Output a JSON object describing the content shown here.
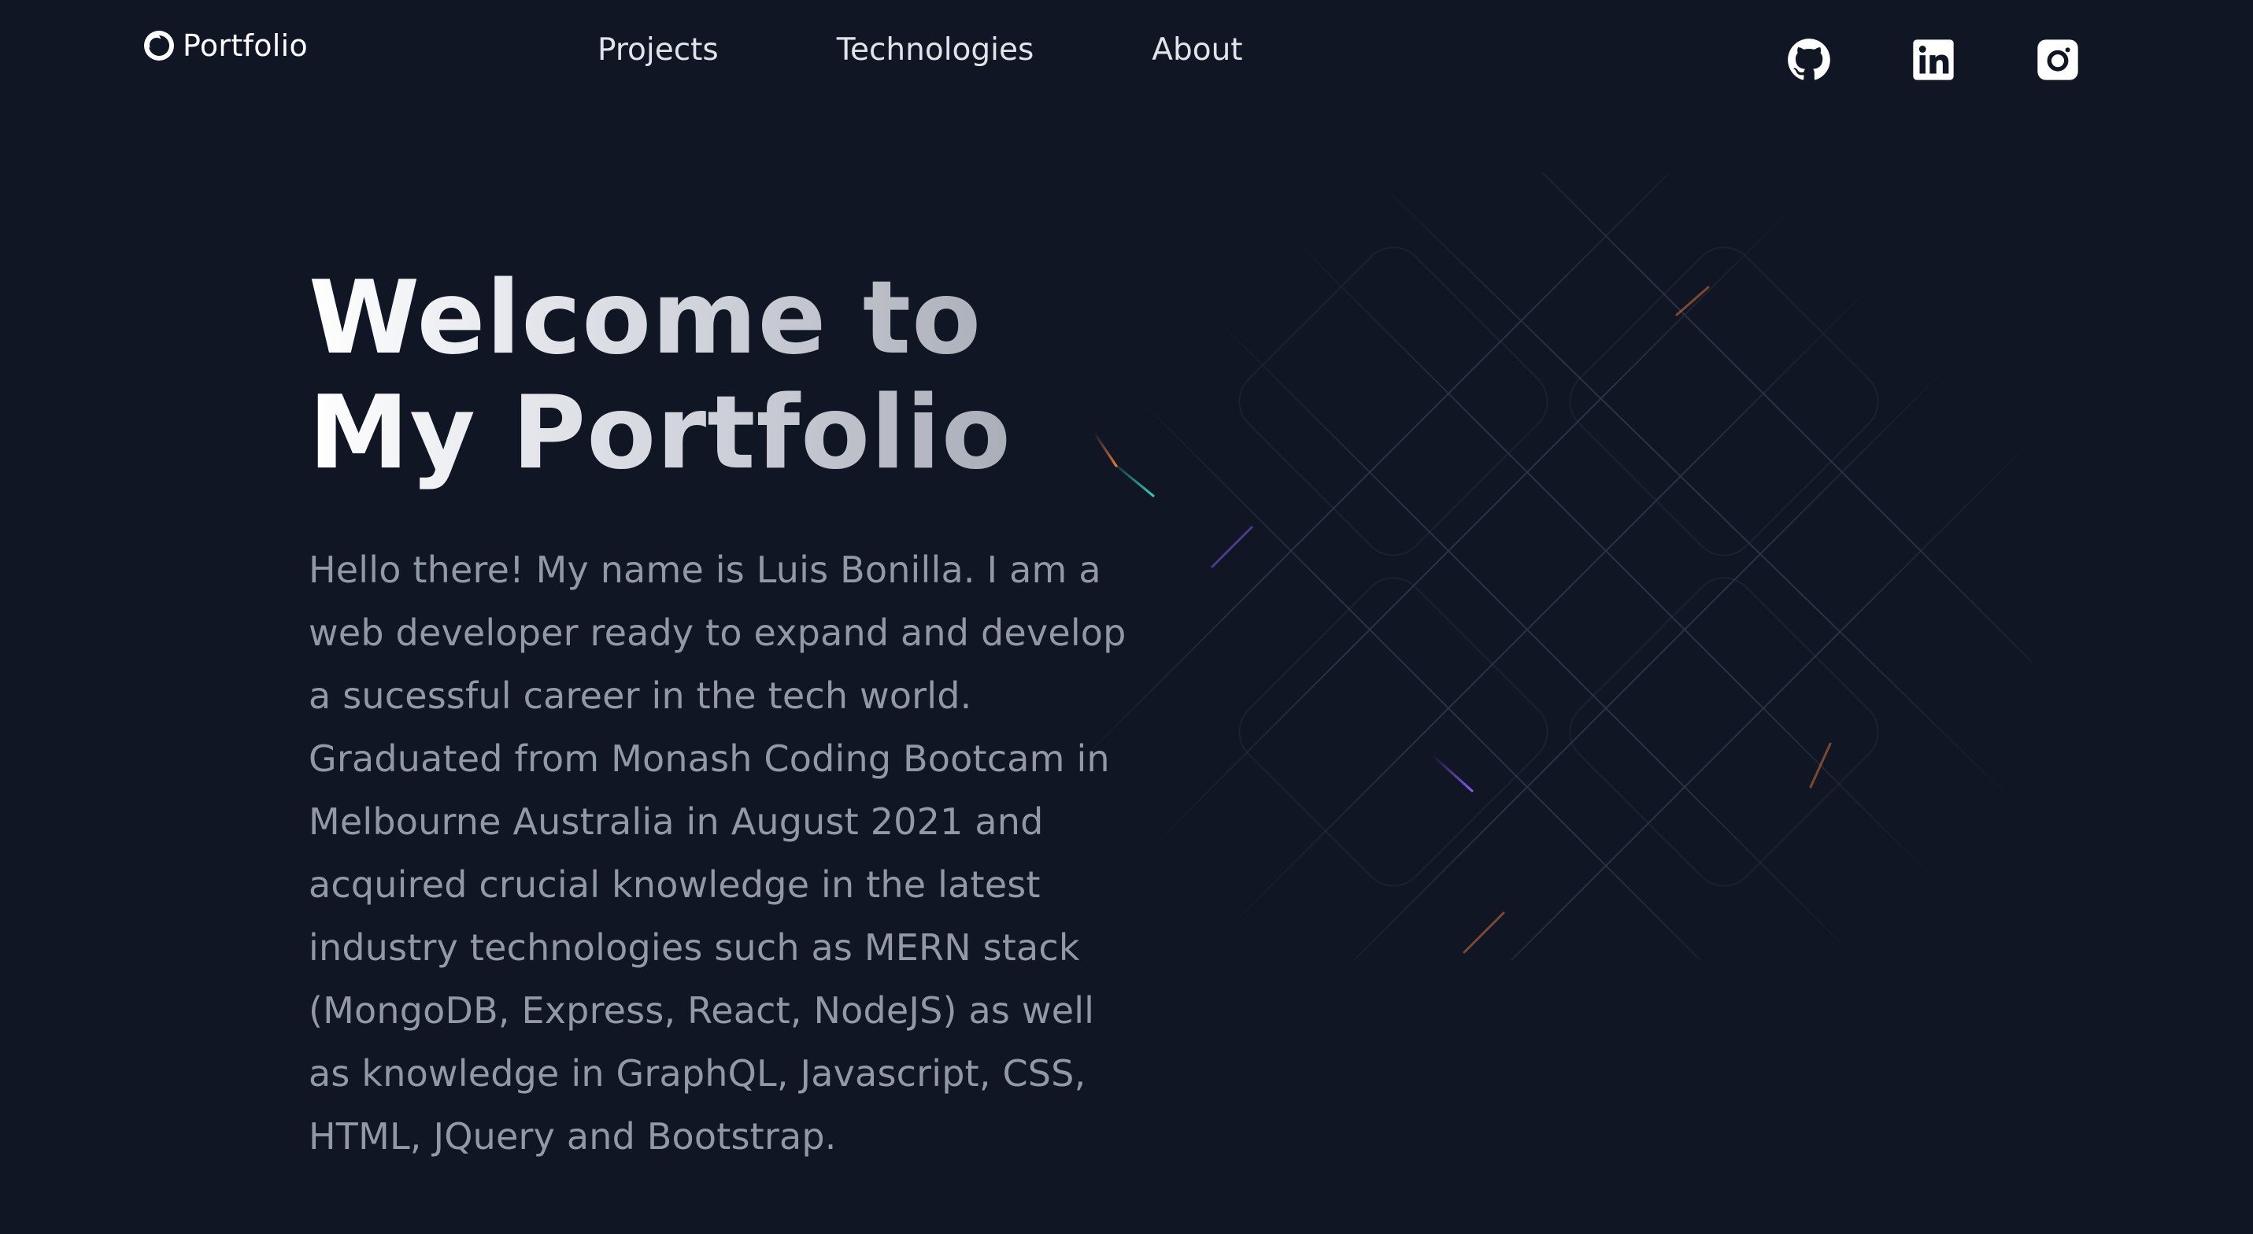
{
  "header": {
    "logo_text": "Portfolio",
    "nav": [
      {
        "label": "Projects"
      },
      {
        "label": "Technologies"
      },
      {
        "label": "About"
      }
    ],
    "socials": [
      {
        "icon": "github-icon"
      },
      {
        "icon": "linkedin-icon"
      },
      {
        "icon": "instagram-icon"
      }
    ]
  },
  "hero": {
    "title_line1": "Welcome to",
    "title_line2": "My Portfolio",
    "bio": "Hello there! My name is Luis Bonilla. I am a web developer ready to expand and develop a sucessful career in the tech world. Graduated from Monash Coding Bootcam in Melbourne Australia in August 2021 and acquired crucial knowledge in the latest industry technologies such as MERN stack (MongoDB, Express, React, NodeJS) as well as knowledge in GraphQL, Javascript, CSS, HTML, JQuery and Bootstrap."
  },
  "colors": {
    "background": "#111624",
    "title_gradient_start": "#ffffff",
    "title_gradient_end": "#a9adb7",
    "body_text": "#9299a6",
    "nav_text": "#dfe3ea",
    "accent_orange": "#e8793a",
    "accent_purple": "#8b5cf6",
    "accent_teal": "#2dd4bf"
  }
}
